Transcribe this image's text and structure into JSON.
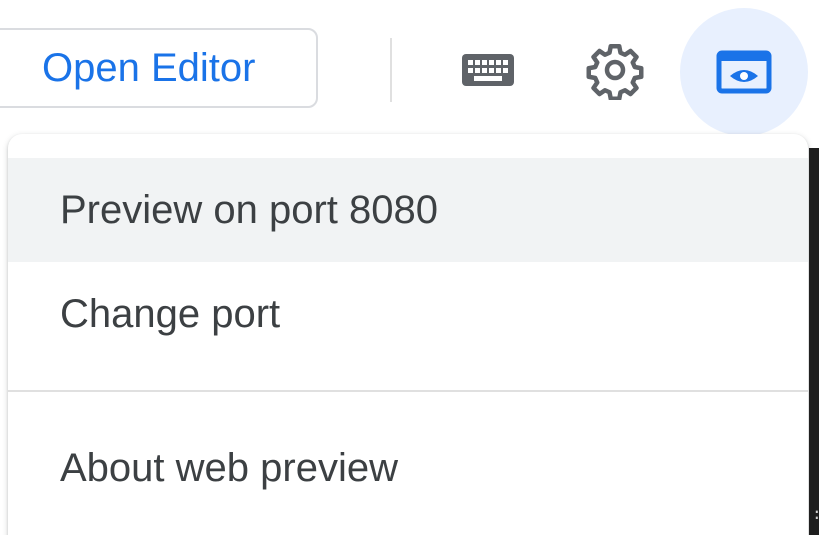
{
  "toolbar": {
    "open_editor_label": "Open Editor",
    "keyboard_icon": "keyboard-icon",
    "settings_icon": "gear-icon",
    "web_preview_icon": "web-preview-icon"
  },
  "menu": {
    "items": [
      {
        "label": "Preview on port 8080",
        "highlighted": true
      },
      {
        "label": "Change port",
        "highlighted": false
      },
      {
        "label": "About web preview",
        "highlighted": false
      }
    ]
  },
  "terminal": {
    "visible_char": ":"
  },
  "colors": {
    "accent": "#1a73e8",
    "menu_text": "#3c4043",
    "highlight_bg": "#f1f3f4",
    "active_icon_bg": "#e8f0fe",
    "icon_gray": "#5f6368"
  }
}
